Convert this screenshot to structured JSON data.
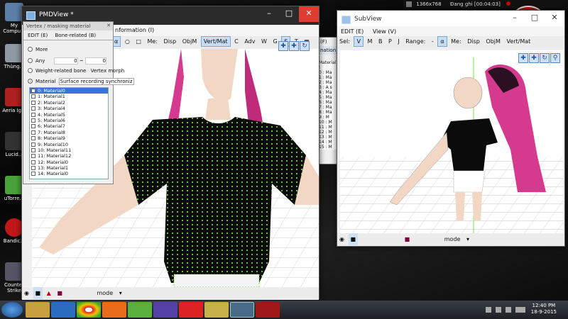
{
  "desktop": {
    "icons": [
      "My Compu...",
      "Thùng...",
      "Aeria Ig...",
      "Lucid...",
      "uTorre...",
      "Bandic...",
      "Counter Strike"
    ]
  },
  "recorder": {
    "resolution": "1366x768",
    "status": "Đang ghi [00:04:03]"
  },
  "pmdview": {
    "title": "PMDView *",
    "menu_partial": "nformation (I)",
    "toolbar": [
      "Me:",
      "Disp",
      "ObjM",
      "Vert/Mat",
      "C",
      "Adv",
      "W",
      "G",
      "S",
      "T"
    ],
    "bottom": [
      "mode"
    ]
  },
  "mask_panel": {
    "title": "Vertex / masking material",
    "tabs": [
      "EDIT (E)",
      "Bone-related (B)"
    ],
    "options": [
      "More",
      "Any",
      "Weight-related bone",
      "Vertex morph",
      "Material",
      "Surface recording synchroniz"
    ],
    "any_values": [
      "0",
      "~",
      "0"
    ],
    "materials": [
      "0: Material0",
      "1: Material1",
      "2: Material2",
      "3: Material4",
      "4: Material5",
      "5: Material6",
      "6: Material7",
      "7: Material8",
      "8: Material9",
      "9: Material10",
      "10: Material11",
      "11: Material12",
      "12: Material0",
      "13: Material1",
      "14: Material0"
    ]
  },
  "subview": {
    "title": "SubView",
    "menu": [
      "EDIT (E)",
      "View (V)"
    ],
    "toolbar": [
      "Sel:",
      "V",
      "M",
      "B",
      "P",
      "J",
      "Range:",
      "-",
      "α",
      "Me:",
      "Disp",
      "ObjM",
      "Vert/Mat"
    ],
    "bottom": [
      "mode"
    ]
  },
  "bg_window": {
    "label": "(F)",
    "tab": "nation",
    "list": [
      "Material I",
      "0 : Ma",
      "1 : Ma",
      "2 : Ma",
      "3 : A s",
      "4 : Ma",
      "5 : Ma",
      "6 : Ma",
      "7 : Ma",
      "8 : Ma",
      "9 : M",
      "10 : M",
      "11 : M",
      "12 : M",
      "13 : M",
      "14 : M",
      "15 : M"
    ]
  },
  "taskbar": {
    "time": "12:40 PM",
    "date": "18-9-2015"
  },
  "colors": {
    "shirt": "#0b0b0b",
    "vertex": "#7be04a",
    "hair": "#d63a8f",
    "selection": "#cde3fa",
    "titlebar": "#2b2b2b",
    "close": "#e03c31"
  }
}
